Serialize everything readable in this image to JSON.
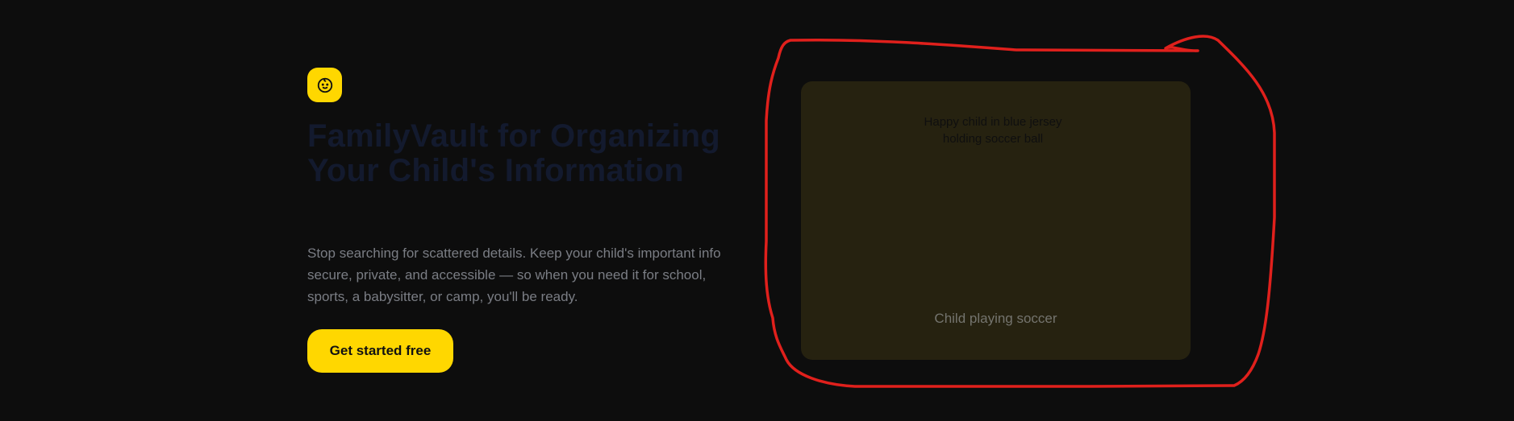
{
  "hero": {
    "logo_icon": "baby-face-icon",
    "headline": "FamilyVault for Organizing Your Child's Information",
    "subcopy": "Stop searching for scattered details. Keep your child's important info secure, private, and accessible — so when you need it for school, sports, a babysitter, or camp, you'll be ready.",
    "cta_label": "Get started free"
  },
  "media": {
    "image_alt": "Happy child in blue jersey holding soccer ball",
    "caption": "Child playing soccer"
  },
  "colors": {
    "background": "#0d0d0d",
    "accent": "#ffd700",
    "headline": "#131a2e",
    "body_text": "#7a7d84",
    "media_placeholder": "#262210",
    "annotation": "#e0201c"
  }
}
